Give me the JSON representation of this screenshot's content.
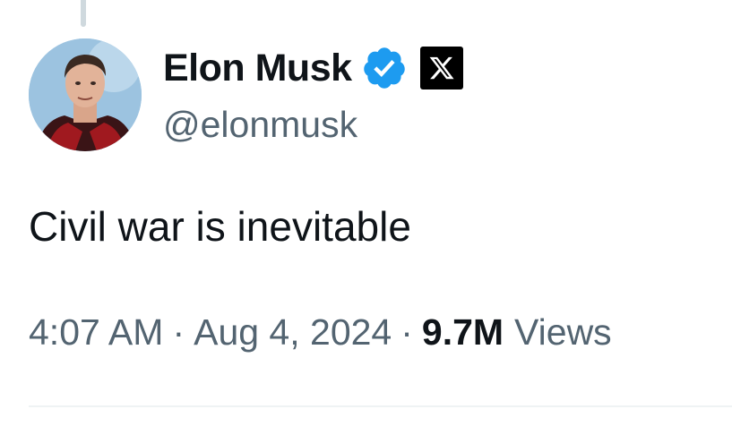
{
  "author": {
    "display_name": "Elon Musk",
    "handle": "@elonmusk",
    "verified": true,
    "affiliate_badge": "x-logo-icon"
  },
  "tweet": {
    "text": "Civil war is inevitable"
  },
  "meta": {
    "time": "4:07 AM",
    "separator": "·",
    "date": "Aug 4, 2024",
    "views_count": "9.7M",
    "views_label": "Views"
  },
  "colors": {
    "verified_blue": "#1d9bf0",
    "primary_text": "#0f1419",
    "secondary_text": "#536471"
  }
}
